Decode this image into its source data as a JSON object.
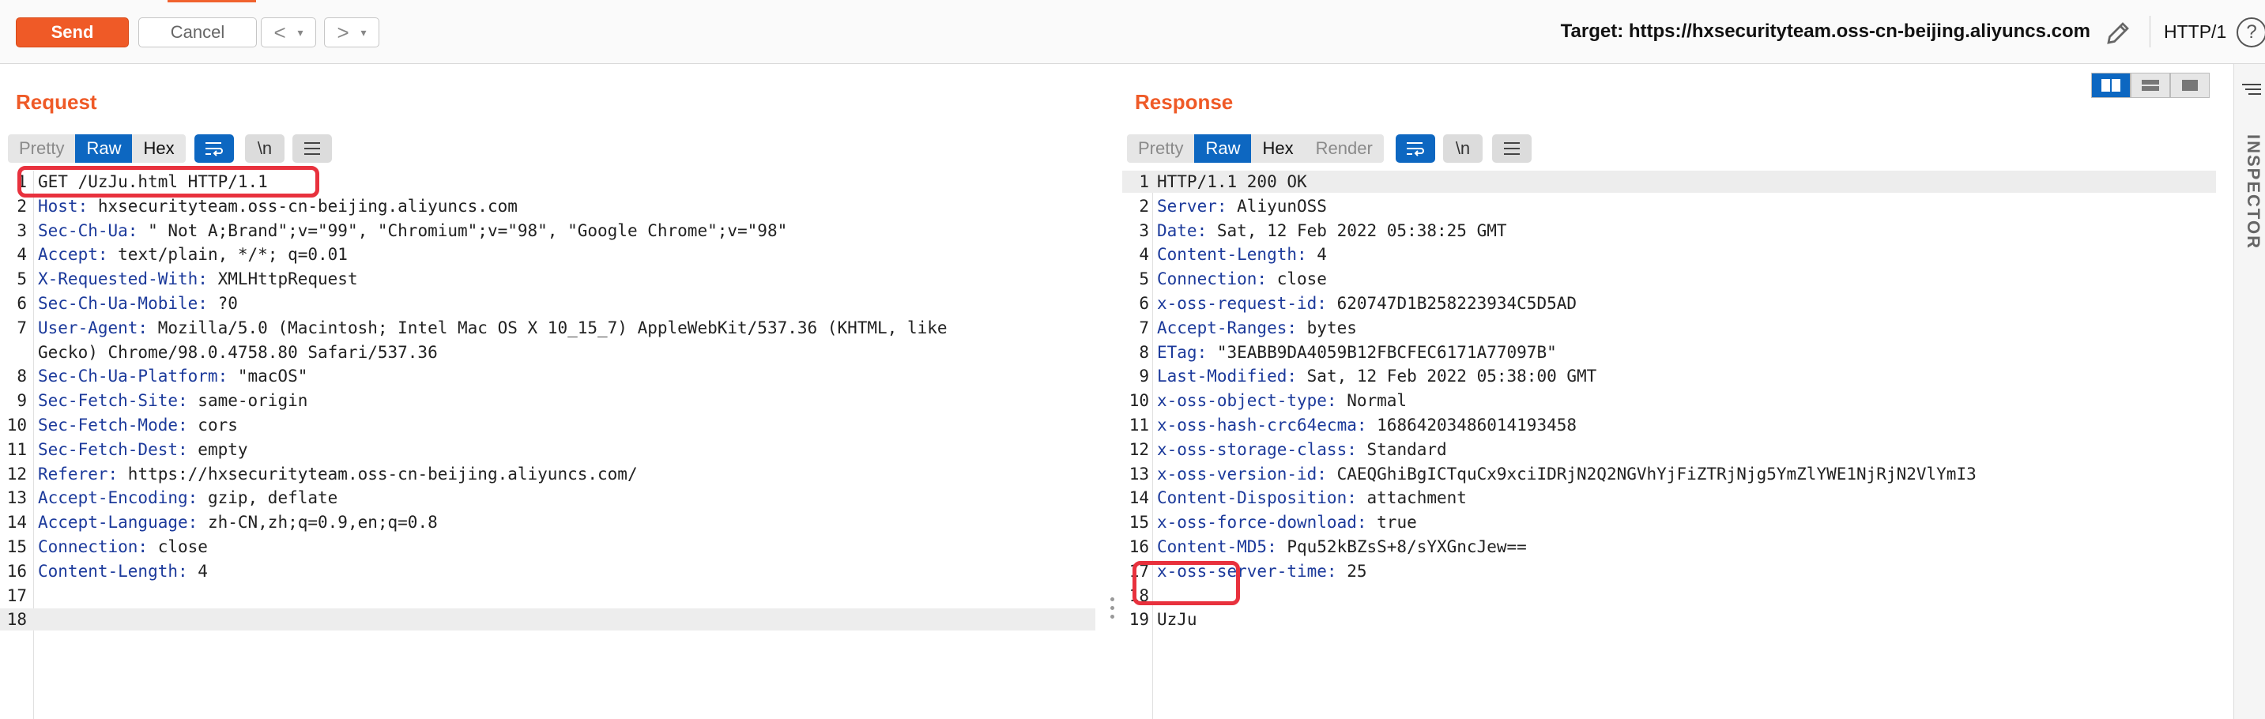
{
  "toolbar": {
    "send_label": "Send",
    "cancel_label": "Cancel",
    "back_symbol": "<",
    "forward_symbol": ">",
    "dropdown_symbol": "▾",
    "target_text": "Target: https://hxsecurityteam.oss-cn-beijing.aliyuncs.com",
    "protocol": "HTTP/1",
    "help_symbol": "?"
  },
  "request": {
    "title": "Request",
    "tabs": [
      "Pretty",
      "Raw",
      "Hex"
    ],
    "active_tab": "Raw",
    "newline_label": "\\n",
    "lines": [
      {
        "n": "1",
        "k": "",
        "v": "GET /UzJu.html HTTP/1.1"
      },
      {
        "n": "2",
        "k": "Host:",
        "v": " hxsecurityteam.oss-cn-beijing.aliyuncs.com"
      },
      {
        "n": "3",
        "k": "Sec-Ch-Ua:",
        "v": " \" Not A;Brand\";v=\"99\", \"Chromium\";v=\"98\", \"Google Chrome\";v=\"98\""
      },
      {
        "n": "4",
        "k": "Accept:",
        "v": " text/plain, */*; q=0.01"
      },
      {
        "n": "5",
        "k": "X-Requested-With:",
        "v": " XMLHttpRequest"
      },
      {
        "n": "6",
        "k": "Sec-Ch-Ua-Mobile:",
        "v": " ?0"
      },
      {
        "n": "7",
        "k": "User-Agent:",
        "v": " Mozilla/5.0 (Macintosh; Intel Mac OS X 10_15_7) AppleWebKit/537.36 (KHTML, like"
      },
      {
        "n": "",
        "k": "",
        "v": "Gecko) Chrome/98.0.4758.80 Safari/537.36"
      },
      {
        "n": "8",
        "k": "Sec-Ch-Ua-Platform:",
        "v": " \"macOS\""
      },
      {
        "n": "9",
        "k": "Sec-Fetch-Site:",
        "v": " same-origin"
      },
      {
        "n": "10",
        "k": "Sec-Fetch-Mode:",
        "v": " cors"
      },
      {
        "n": "11",
        "k": "Sec-Fetch-Dest:",
        "v": " empty"
      },
      {
        "n": "12",
        "k": "Referer:",
        "v": " https://hxsecurityteam.oss-cn-beijing.aliyuncs.com/"
      },
      {
        "n": "13",
        "k": "Accept-Encoding:",
        "v": " gzip, deflate"
      },
      {
        "n": "14",
        "k": "Accept-Language:",
        "v": " zh-CN,zh;q=0.9,en;q=0.8"
      },
      {
        "n": "15",
        "k": "Connection:",
        "v": " close"
      },
      {
        "n": "16",
        "k": "Content-Length:",
        "v": " 4"
      },
      {
        "n": "17",
        "k": "",
        "v": ""
      },
      {
        "n": "18",
        "k": "",
        "v": ""
      }
    ]
  },
  "response": {
    "title": "Response",
    "tabs": [
      "Pretty",
      "Raw",
      "Hex",
      "Render"
    ],
    "active_tab": "Raw",
    "newline_label": "\\n",
    "lines": [
      {
        "n": "1",
        "k": "",
        "v": "HTTP/1.1 200 OK"
      },
      {
        "n": "2",
        "k": "Server:",
        "v": " AliyunOSS"
      },
      {
        "n": "3",
        "k": "Date:",
        "v": " Sat, 12 Feb 2022 05:38:25 GMT"
      },
      {
        "n": "4",
        "k": "Content-Length:",
        "v": " 4"
      },
      {
        "n": "5",
        "k": "Connection:",
        "v": " close"
      },
      {
        "n": "6",
        "k": "x-oss-request-id:",
        "v": " 620747D1B258223934C5D5AD"
      },
      {
        "n": "7",
        "k": "Accept-Ranges:",
        "v": " bytes"
      },
      {
        "n": "8",
        "k": "ETag:",
        "v": " \"3EABB9DA4059B12FBCFEC6171A77097B\""
      },
      {
        "n": "9",
        "k": "Last-Modified:",
        "v": " Sat, 12 Feb 2022 05:38:00 GMT"
      },
      {
        "n": "10",
        "k": "x-oss-object-type:",
        "v": " Normal"
      },
      {
        "n": "11",
        "k": "x-oss-hash-crc64ecma:",
        "v": " 16864203486014193458"
      },
      {
        "n": "12",
        "k": "x-oss-storage-class:",
        "v": " Standard"
      },
      {
        "n": "13",
        "k": "x-oss-version-id:",
        "v": " CAEQGhiBgICTquCx9xciIDRjN2Q2NGVhYjFiZTRjNjg5YmZlYWE1NjRjN2VlYmI3"
      },
      {
        "n": "14",
        "k": "Content-Disposition:",
        "v": " attachment"
      },
      {
        "n": "15",
        "k": "x-oss-force-download:",
        "v": " true"
      },
      {
        "n": "16",
        "k": "Content-MD5:",
        "v": " Pqu52kBZsS+8/sYXGncJew=="
      },
      {
        "n": "17",
        "k": "x-oss-server-time:",
        "v": " 25"
      },
      {
        "n": "18",
        "k": "",
        "v": ""
      },
      {
        "n": "19",
        "k": "",
        "v": "UzJu"
      }
    ]
  },
  "sidebar": {
    "inspector_label": "INSPECTOR"
  },
  "colors": {
    "accent": "#ef5a27",
    "tab_active": "#0d67c1",
    "header_key": "#1c3a9b",
    "highlight": "#e8313d"
  }
}
